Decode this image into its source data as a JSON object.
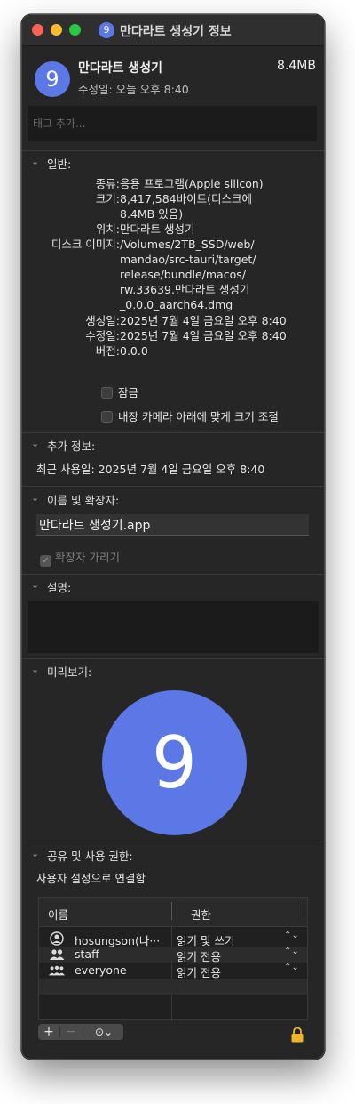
{
  "window": {
    "title": "만다라트 생성기 정보",
    "title_icon": "9"
  },
  "app": {
    "icon_glyph": "9",
    "name": "만다라트 생성기",
    "size": "8.4MB",
    "modified": "수정일: 오늘 오후 8:40"
  },
  "tags": {
    "placeholder": "태그 추가..."
  },
  "general": {
    "header": "일반:",
    "kind_label": "종류:",
    "kind_value": "응용 프로그램(Apple silicon)",
    "size_label": "크기:",
    "size_value_1": "8,417,584바이트(디스크에",
    "size_value_2": "8.4MB 있음)",
    "where_label": "위치:",
    "where_value": "만다라트 생성기",
    "disk_label": "디스크 이미지:",
    "disk_value_1": "/Volumes/2TB_SSD/web/",
    "disk_value_2": "mandao/src-tauri/target/",
    "disk_value_3": "release/bundle/macos/",
    "disk_value_4": "rw.33639.만다라트 생성기",
    "disk_value_5": "_0.0.0_aarch64.dmg",
    "created_label": "생성일:",
    "created_value": "2025년 7월 4일 금요일 오후 8:40",
    "modified_label": "수정일:",
    "modified_value": "2025년 7월 4일 금요일 오후 8:40",
    "version_label": "버전:",
    "version_value": "0.0.0",
    "locked_label": "잠금",
    "camera_label": "내장 카메라 아래에 맞게 크기 조절"
  },
  "more_info": {
    "header": "추가 정보:",
    "last_opened": "최근 사용일: 2025년 7월 4일 금요일 오후 8:40"
  },
  "name_ext": {
    "header": "이름 및 확장자:",
    "value": "만다라트 생성기.app",
    "hide_ext_label": "확장자 가리기",
    "hide_ext_checked": true
  },
  "comments": {
    "header": "설명:"
  },
  "preview": {
    "header": "미리보기:",
    "glyph": "9"
  },
  "permissions": {
    "header": "공유 및 사용 권한:",
    "subtitle": "사용자 설정으로 연결함",
    "col_name": "이름",
    "col_priv": "권한",
    "rows": [
      {
        "icon": "user-icon",
        "name": "hosungson(나···",
        "priv": "읽기 및 쓰기"
      },
      {
        "icon": "group-icon",
        "name": "staff",
        "priv": "읽기 전용"
      },
      {
        "icon": "everyone-icon",
        "name": "everyone",
        "priv": "읽기 전용"
      }
    ]
  },
  "toolbar": {
    "add": "+",
    "remove": "−",
    "more": "⊙⌄"
  },
  "colors": {
    "window_bg": "#262626",
    "accent_icon": "#5b78e6",
    "lock": "#f0b429"
  }
}
